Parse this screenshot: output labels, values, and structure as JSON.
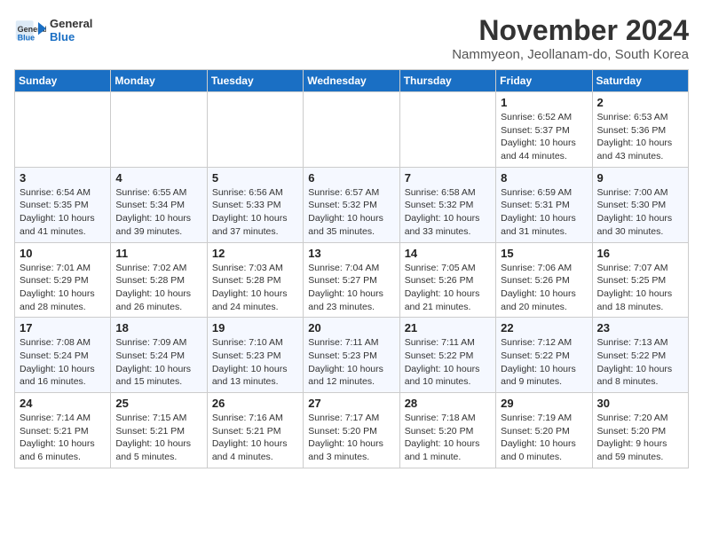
{
  "header": {
    "logo_line1": "General",
    "logo_line2": "Blue",
    "month": "November 2024",
    "location": "Nammyeon, Jeollanam-do, South Korea"
  },
  "weekdays": [
    "Sunday",
    "Monday",
    "Tuesday",
    "Wednesday",
    "Thursday",
    "Friday",
    "Saturday"
  ],
  "weeks": [
    [
      {
        "day": "",
        "info": ""
      },
      {
        "day": "",
        "info": ""
      },
      {
        "day": "",
        "info": ""
      },
      {
        "day": "",
        "info": ""
      },
      {
        "day": "",
        "info": ""
      },
      {
        "day": "1",
        "info": "Sunrise: 6:52 AM\nSunset: 5:37 PM\nDaylight: 10 hours and 44 minutes."
      },
      {
        "day": "2",
        "info": "Sunrise: 6:53 AM\nSunset: 5:36 PM\nDaylight: 10 hours and 43 minutes."
      }
    ],
    [
      {
        "day": "3",
        "info": "Sunrise: 6:54 AM\nSunset: 5:35 PM\nDaylight: 10 hours and 41 minutes."
      },
      {
        "day": "4",
        "info": "Sunrise: 6:55 AM\nSunset: 5:34 PM\nDaylight: 10 hours and 39 minutes."
      },
      {
        "day": "5",
        "info": "Sunrise: 6:56 AM\nSunset: 5:33 PM\nDaylight: 10 hours and 37 minutes."
      },
      {
        "day": "6",
        "info": "Sunrise: 6:57 AM\nSunset: 5:32 PM\nDaylight: 10 hours and 35 minutes."
      },
      {
        "day": "7",
        "info": "Sunrise: 6:58 AM\nSunset: 5:32 PM\nDaylight: 10 hours and 33 minutes."
      },
      {
        "day": "8",
        "info": "Sunrise: 6:59 AM\nSunset: 5:31 PM\nDaylight: 10 hours and 31 minutes."
      },
      {
        "day": "9",
        "info": "Sunrise: 7:00 AM\nSunset: 5:30 PM\nDaylight: 10 hours and 30 minutes."
      }
    ],
    [
      {
        "day": "10",
        "info": "Sunrise: 7:01 AM\nSunset: 5:29 PM\nDaylight: 10 hours and 28 minutes."
      },
      {
        "day": "11",
        "info": "Sunrise: 7:02 AM\nSunset: 5:28 PM\nDaylight: 10 hours and 26 minutes."
      },
      {
        "day": "12",
        "info": "Sunrise: 7:03 AM\nSunset: 5:28 PM\nDaylight: 10 hours and 24 minutes."
      },
      {
        "day": "13",
        "info": "Sunrise: 7:04 AM\nSunset: 5:27 PM\nDaylight: 10 hours and 23 minutes."
      },
      {
        "day": "14",
        "info": "Sunrise: 7:05 AM\nSunset: 5:26 PM\nDaylight: 10 hours and 21 minutes."
      },
      {
        "day": "15",
        "info": "Sunrise: 7:06 AM\nSunset: 5:26 PM\nDaylight: 10 hours and 20 minutes."
      },
      {
        "day": "16",
        "info": "Sunrise: 7:07 AM\nSunset: 5:25 PM\nDaylight: 10 hours and 18 minutes."
      }
    ],
    [
      {
        "day": "17",
        "info": "Sunrise: 7:08 AM\nSunset: 5:24 PM\nDaylight: 10 hours and 16 minutes."
      },
      {
        "day": "18",
        "info": "Sunrise: 7:09 AM\nSunset: 5:24 PM\nDaylight: 10 hours and 15 minutes."
      },
      {
        "day": "19",
        "info": "Sunrise: 7:10 AM\nSunset: 5:23 PM\nDaylight: 10 hours and 13 minutes."
      },
      {
        "day": "20",
        "info": "Sunrise: 7:11 AM\nSunset: 5:23 PM\nDaylight: 10 hours and 12 minutes."
      },
      {
        "day": "21",
        "info": "Sunrise: 7:11 AM\nSunset: 5:22 PM\nDaylight: 10 hours and 10 minutes."
      },
      {
        "day": "22",
        "info": "Sunrise: 7:12 AM\nSunset: 5:22 PM\nDaylight: 10 hours and 9 minutes."
      },
      {
        "day": "23",
        "info": "Sunrise: 7:13 AM\nSunset: 5:22 PM\nDaylight: 10 hours and 8 minutes."
      }
    ],
    [
      {
        "day": "24",
        "info": "Sunrise: 7:14 AM\nSunset: 5:21 PM\nDaylight: 10 hours and 6 minutes."
      },
      {
        "day": "25",
        "info": "Sunrise: 7:15 AM\nSunset: 5:21 PM\nDaylight: 10 hours and 5 minutes."
      },
      {
        "day": "26",
        "info": "Sunrise: 7:16 AM\nSunset: 5:21 PM\nDaylight: 10 hours and 4 minutes."
      },
      {
        "day": "27",
        "info": "Sunrise: 7:17 AM\nSunset: 5:20 PM\nDaylight: 10 hours and 3 minutes."
      },
      {
        "day": "28",
        "info": "Sunrise: 7:18 AM\nSunset: 5:20 PM\nDaylight: 10 hours and 1 minute."
      },
      {
        "day": "29",
        "info": "Sunrise: 7:19 AM\nSunset: 5:20 PM\nDaylight: 10 hours and 0 minutes."
      },
      {
        "day": "30",
        "info": "Sunrise: 7:20 AM\nSunset: 5:20 PM\nDaylight: 9 hours and 59 minutes."
      }
    ]
  ]
}
